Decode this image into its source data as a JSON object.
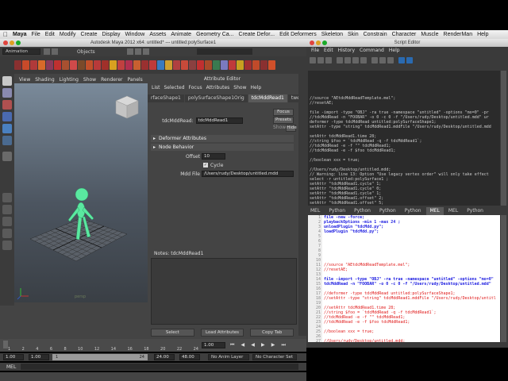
{
  "mac_menu": {
    "app": "Maya",
    "items": [
      "File",
      "Edit",
      "Modify",
      "Create",
      "Display",
      "Window",
      "Assets",
      "Animate",
      "Geometry Ca...",
      "Create Defor...",
      "Edit Deformers",
      "Skeleton",
      "Skin",
      "Constrain",
      "Character",
      "Muscle",
      "RenderMan",
      "Help"
    ]
  },
  "maya_window": {
    "title": "Autodesk Maya 2012 x64: untitled*   ---   untitled:polySurface1",
    "mode_menu": "Animation",
    "objects_label": "Objects"
  },
  "viewport": {
    "menu": [
      "View",
      "Shading",
      "Lighting",
      "Show",
      "Renderer",
      "Panels"
    ],
    "corner_label": "persp"
  },
  "attribute_editor": {
    "title": "Attribute Editor",
    "menu": [
      "List",
      "Selected",
      "Focus",
      "Attributes",
      "Show",
      "Help"
    ],
    "tabs": [
      "rfaceShape1",
      "polySurfaceShape1Orig",
      "tdcMddRead1",
      "tweak1"
    ],
    "active_tab": "tdcMddRead1",
    "node_label": "tdcMddRead:",
    "node_value": "tdcMddRead1",
    "focus_button": "Focus",
    "presets_button": "Presets",
    "show_button": "Show",
    "hide_button": "Hide",
    "section_attrs": "Deformer Attributes",
    "section_node": "Node Behavior",
    "offset_label": "Offset",
    "offset_value": "10",
    "cycle_label": "Cycle",
    "mddfile_label": "Mdd File",
    "mddfile_value": "/Users/rudy/Desktop/untitled.mdd",
    "notes_label": "Notes:  tdcMddRead1",
    "select_button": "Select",
    "load_button": "Load Attributes",
    "copy_button": "Copy Tab"
  },
  "timeline": {
    "ticks": [
      "1",
      "2",
      "4",
      "6",
      "8",
      "10",
      "12",
      "14",
      "16",
      "18",
      "20",
      "22",
      "24"
    ],
    "current_frame": "1.00",
    "range_start": "1.00",
    "range_start2": "1.00",
    "range_mid": "1",
    "range_mid2": "24",
    "range_end": "24.00",
    "range_end2": "48.00",
    "anim_layer": "No Anim Layer",
    "char_set": "No Character Set"
  },
  "command_line": {
    "label": "MEL"
  },
  "script_editor": {
    "title": "Script Editor",
    "menu": [
      "File",
      "Edit",
      "History",
      "Command",
      "Help"
    ],
    "history_lines": [
      "",
      "",
      "",
      "",
      "",
      "//source \"AEtdcMddReadTemplate.mel\";",
      "//resetAE;",
      "",
      "file -import -type \"OBJ\" -ra true -namespace \"untitled\" -options \"mo=0\" -pr",
      "//tdcMddRead -n \"FOOBAR\" -o 0 -c 0 -f \"/Users/rudy/Desktop/untitled.mdd\" ur",
      "deformer -type tdcMddRead untitled:polySurfaceShape1;",
      "setAttr -type \"string\" tdcMddRead1.mddFile \"/Users/rudy/Desktop/untitled.mdd",
      "",
      "setAttr tdcMddRead1.time 28;",
      "//string $foo = `tdcMddRead -q -f tdcMddRead1`;",
      "//tdcMddRead -e -f \"\" tdcMddRead1;",
      "//tdcMddRead -e -f $foo tdcMddRead1;",
      "",
      "//boolean xxx = true;",
      "",
      "//Users/rudy/Desktop/untitled.mdd;",
      "// Warning: line 13: Option \"Use legacy vertex order\" will only take effect",
      "select -r untitled:polySurface1 ;",
      "setAttr \"tdcMddRead1.cycle\" 1;",
      "setAttr \"tdcMddRead1.cycle\" 0;",
      "setAttr \"tdcMddRead1.cycle\" 1;",
      "setAttr \"tdcMddRead1.offset\" 2;",
      "setAttr \"tdcMddRead1.offset\" 5;",
      "setAttr \"tdcMddRead1.offset\" 3;",
      "setAttr \"tdcMddRead1.offset\" 4;",
      "setAttr \"tdcMddRead1.offset\" 10;"
    ],
    "tabs": [
      "MEL",
      "Python",
      "Python",
      "Python",
      "Python",
      "MEL",
      "MEL",
      "Python"
    ],
    "active_tab_index": 5,
    "input_lines": [
      {
        "n": "1",
        "t": "file -new -force;",
        "c": "kw"
      },
      {
        "n": "2",
        "t": "playbackOptions -min 1 -max 24 ;",
        "c": "kw"
      },
      {
        "n": "3",
        "t": "unloadPlugin \"tdcMdd.py\";",
        "c": "kw"
      },
      {
        "n": "4",
        "t": "loadPlugin \"tdcMdd.py\";",
        "c": "kw"
      },
      {
        "n": "5",
        "t": "",
        "c": ""
      },
      {
        "n": "6",
        "t": "",
        "c": ""
      },
      {
        "n": "7",
        "t": "",
        "c": ""
      },
      {
        "n": "8",
        "t": "",
        "c": ""
      },
      {
        "n": "9",
        "t": "",
        "c": ""
      },
      {
        "n": "10",
        "t": "",
        "c": ""
      },
      {
        "n": "11",
        "t": "//source \"AEtdcMddReadTemplate.mel\";",
        "c": "red"
      },
      {
        "n": "12",
        "t": "//resetAE;",
        "c": "red"
      },
      {
        "n": "13",
        "t": "",
        "c": ""
      },
      {
        "n": "14",
        "t": "file -import -type \"OBJ\" -ra true -namespace \"untitled\" -options \"mo=0\"",
        "c": "kw"
      },
      {
        "n": "15",
        "t": "tdcMddRead -n \"FOOBAR\" -o 0 -c 0 -f \"/Users/rudy/Desktop/untitled.mdd\"",
        "c": "kw"
      },
      {
        "n": "16",
        "t": "",
        "c": ""
      },
      {
        "n": "17",
        "t": "//deformer -type tdcMddRead untitled:polySurfaceShape1;",
        "c": "red"
      },
      {
        "n": "18",
        "t": "//setAttr -type \"string\" tdcMddRead1.mddFile \"/Users/rudy/Desktop/untitl",
        "c": "red"
      },
      {
        "n": "19",
        "t": "",
        "c": ""
      },
      {
        "n": "20",
        "t": "//setAttr tdcMddRead1.time 28;",
        "c": "red"
      },
      {
        "n": "21",
        "t": "//string $foo = `tdcMddRead -q -f tdcMddRead1`;",
        "c": "red"
      },
      {
        "n": "22",
        "t": "//tdcMddRead -e -f \"\" tdcMddRead1;",
        "c": "red"
      },
      {
        "n": "23",
        "t": "//tdcMddRead -e -f $foo tdcMddRead1;",
        "c": "red"
      },
      {
        "n": "24",
        "t": "",
        "c": ""
      },
      {
        "n": "25",
        "t": "//boolean xxx = true;",
        "c": "red"
      },
      {
        "n": "26",
        "t": "",
        "c": ""
      },
      {
        "n": "27",
        "t": "//Users/rudy/Desktop/untitled.mdd;",
        "c": "red"
      }
    ]
  }
}
